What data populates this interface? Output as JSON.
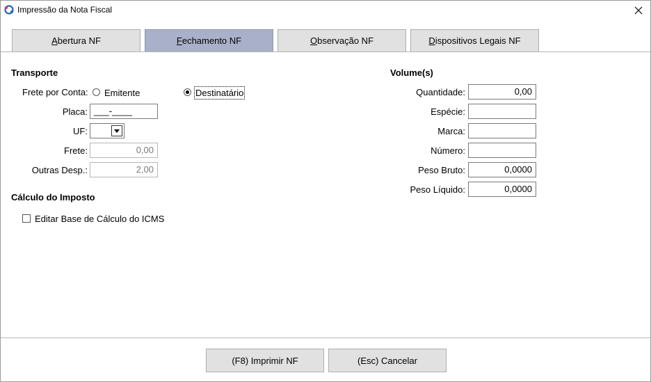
{
  "window": {
    "title": "Impressão da Nota Fiscal"
  },
  "tabs": [
    {
      "pre": "",
      "accel": "A",
      "post": "bertura NF"
    },
    {
      "pre": "",
      "accel": "F",
      "post": "echamento NF"
    },
    {
      "pre": "",
      "accel": "O",
      "post": "bservação NF"
    },
    {
      "pre": "",
      "accel": "D",
      "post": "ispositivos Legais NF"
    }
  ],
  "active_tab": 1,
  "transporte": {
    "section_title": "Transporte",
    "frete_por_conta_label": "Frete por Conta:",
    "options": [
      "Emitente",
      "Destinatário"
    ],
    "selected_option": "Destinatário",
    "placa_label": "Placa:",
    "placa_value": "___-____",
    "uf_label": "UF:",
    "uf_value": "",
    "frete_label": "Frete:",
    "frete_value": "0,00",
    "outras_label": "Outras Desp.:",
    "outras_value": "2,00"
  },
  "calculo": {
    "section_title": "Cálculo do Imposto",
    "editar_base_label": "Editar Base de Cálculo do ICMS",
    "editar_base_checked": false
  },
  "volume": {
    "section_title": "Volume(s)",
    "quantidade_label": "Quantidade:",
    "quantidade_value": "0,00",
    "especie_label": "Espécie:",
    "especie_value": "",
    "marca_label": "Marca:",
    "marca_value": "",
    "numero_label": "Número:",
    "numero_value": "",
    "peso_bruto_label": "Peso Bruto:",
    "peso_bruto_value": "0,0000",
    "peso_liquido_label": "Peso Líquido:",
    "peso_liquido_value": "0,0000"
  },
  "buttons": {
    "print_label": "(F8) Imprimir NF",
    "cancel_label": "(Esc) Cancelar"
  },
  "colors": {
    "active_tab": "#a8b1c9",
    "tab": "#e1e1e1",
    "button": "#e1e1e1"
  }
}
